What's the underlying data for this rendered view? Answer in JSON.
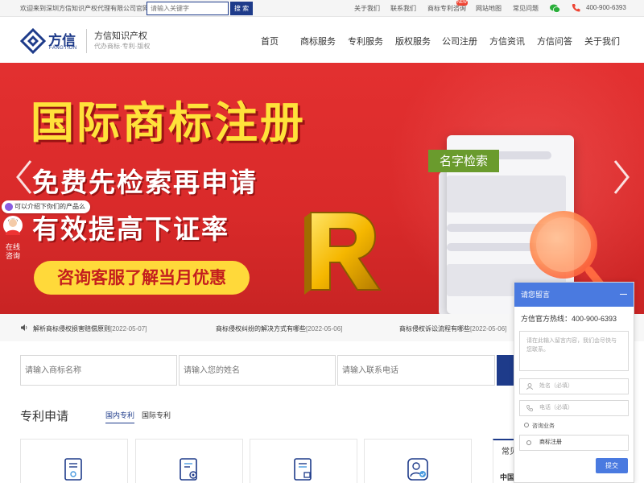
{
  "topbar": {
    "welcome": "欢迎来到深圳方信知识产权代理有限公司官网！",
    "search_placeholder": "请输入关键字",
    "search_button": "搜 索",
    "links": [
      {
        "label": "关于我们"
      },
      {
        "label": "联系我们"
      },
      {
        "label": "商标专利咨询"
      },
      {
        "label": "网站地图"
      },
      {
        "label": "常见问题"
      }
    ],
    "hot_badge": "NEW",
    "phone": "400-900-6393"
  },
  "header": {
    "brand": "方信",
    "brand_en": "FANGTION",
    "tagline": "方信知识产权",
    "sub_tagline": "代办商标·专利·版权"
  },
  "nav": {
    "items": [
      {
        "label": "首页"
      },
      {
        "label": "商标服务"
      },
      {
        "label": "专利服务"
      },
      {
        "label": "版权服务"
      },
      {
        "label": "公司注册"
      },
      {
        "label": "方信资讯"
      },
      {
        "label": "方信问答"
      },
      {
        "label": "关于我们"
      }
    ]
  },
  "banner": {
    "title": "国际商标注册",
    "sub1": "免费先检索再申请",
    "sub2": "有效提高下证率",
    "cta": "咨询客服了解当月优惠",
    "search_tag": "名字检索",
    "r_letter": "R"
  },
  "consult": {
    "bubble": "可以介绍下你们的产品么",
    "label": "在线咨询"
  },
  "news": {
    "items": [
      {
        "title": "解析商标侵权损害赔偿原则",
        "date": "[2022-05-07]"
      },
      {
        "title": "商标侵权纠纷的解决方式有哪些",
        "date": "[2022-05-06]"
      },
      {
        "title": "商标侵权诉讼流程有哪些",
        "date": "[2022-05-06]"
      }
    ]
  },
  "form": {
    "trademark_placeholder": "请输入商标名称",
    "name_placeholder": "请输入您的姓名",
    "phone_placeholder": "请输入联系电话"
  },
  "patent": {
    "title": "专利申请",
    "tabs": [
      {
        "label": "国内专利"
      },
      {
        "label": "国际专利"
      }
    ]
  },
  "faq": {
    "title": "常见",
    "line": "中国"
  },
  "message": {
    "title": "请您留言",
    "hotline": "方信官方热线：400-900-6393",
    "textarea_placeholder": "请在此输入留言内容，我们会尽快与您联系。",
    "name_placeholder": "姓名（必填）",
    "phone_placeholder": "电话（必填）",
    "business_label": "咨询业务",
    "business_selected": "商标注册",
    "submit": "提交"
  },
  "colors": {
    "brand_blue": "#1e3b8a",
    "banner_red": "#e33030",
    "banner_yellow": "#ffe23a",
    "panel_blue": "#4a7ae0"
  }
}
